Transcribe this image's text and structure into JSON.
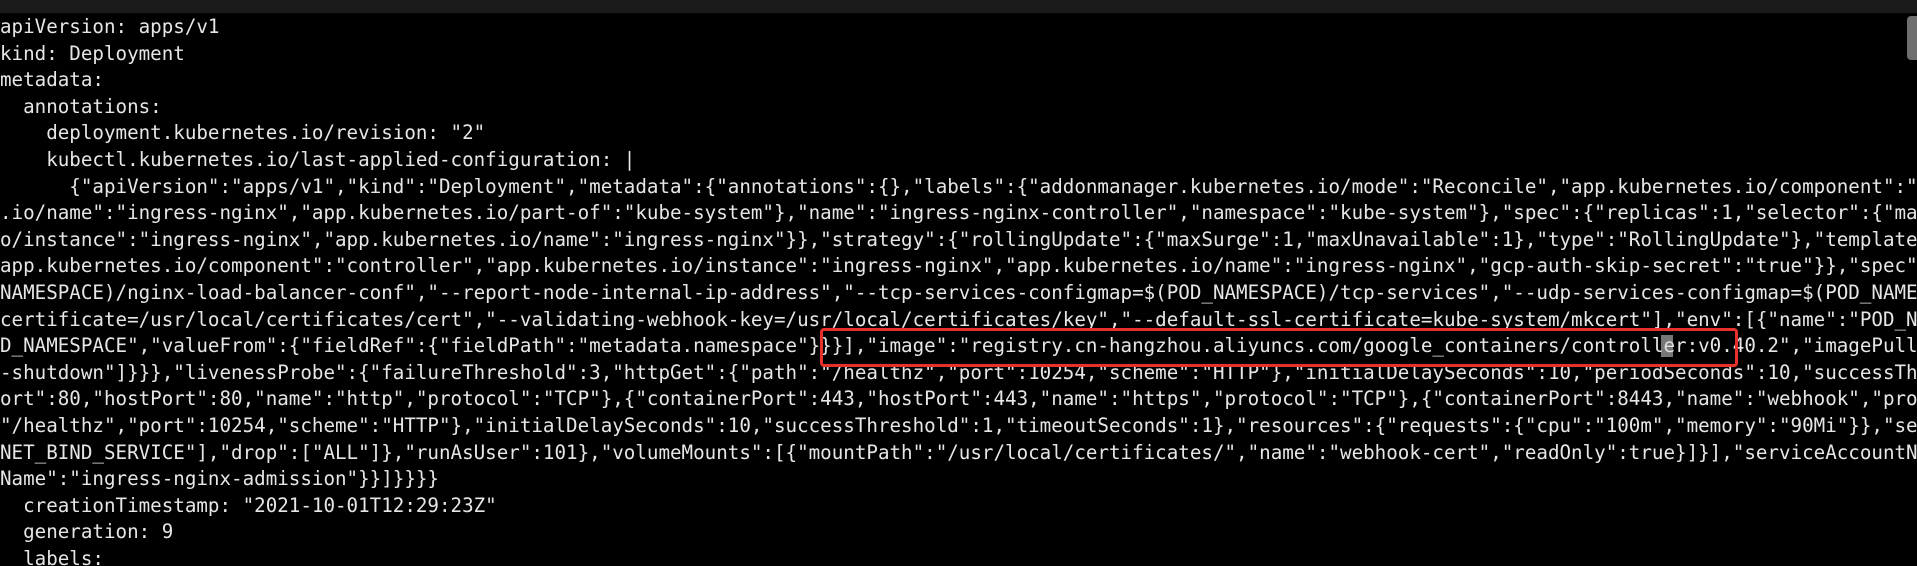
{
  "terminal": {
    "lines": [
      "apiVersion: apps/v1",
      "kind: Deployment",
      "metadata:",
      "  annotations:",
      "    deployment.kubernetes.io/revision: \"2\"",
      "    kubectl.kubernetes.io/last-applied-configuration: |",
      "      {\"apiVersion\":\"apps/v1\",\"kind\":\"Deployment\",\"metadata\":{\"annotations\":{},\"labels\":{\"addonmanager.kubernetes.io/mode\":\"Reconcile\",\"app.kubernetes.io/component\":\"contr",
      ".io/name\":\"ingress-nginx\",\"app.kubernetes.io/part-of\":\"kube-system\"},\"name\":\"ingress-nginx-controller\",\"namespace\":\"kube-system\"},\"spec\":{\"replicas\":1,\"selector\":{\"matchLa",
      "o/instance\":\"ingress-nginx\",\"app.kubernetes.io/name\":\"ingress-nginx\"}},\"strategy\":{\"rollingUpdate\":{\"maxSurge\":1,\"maxUnavailable\":1},\"type\":\"RollingUpdate\"},\"template\":{\"m",
      "app.kubernetes.io/component\":\"controller\",\"app.kubernetes.io/instance\":\"ingress-nginx\",\"app.kubernetes.io/name\":\"ingress-nginx\",\"gcp-auth-skip-secret\":\"true\"}},\"spec\":{\"co",
      "NAMESPACE)/nginx-load-balancer-conf\",\"--report-node-internal-ip-address\",\"--tcp-services-configmap=$(POD_NAMESPACE)/tcp-services\",\"--udp-services-configmap=$(POD_NAMESPACE",
      "certificate=/usr/local/certificates/cert\",\"--validating-webhook-key=/usr/local/certificates/key\",\"--default-ssl-certificate=kube-system/mkcert\"],\"env\":[{\"name\":\"POD_NAME\",",
      "D_NAMESPACE\",\"valueFrom\":{\"fieldRef\":{\"fieldPath\":\"metadata.namespace\"}}}],\"image\":\"registry.cn-hangzhou.aliyuncs.com/google_containers/controller:v0.40.2\",\"imagePullPolic",
      "-shutdown\"]}}},\"livenessProbe\":{\"failureThreshold\":3,\"httpGet\":{\"path\":\"/healthz\",\"port\":10254,\"scheme\":\"HTTP\"},\"initialDelaySeconds\":10,\"periodSeconds\":10,\"successThresh",
      "ort\":80,\"hostPort\":80,\"name\":\"http\",\"protocol\":\"TCP\"},{\"containerPort\":443,\"hostPort\":443,\"name\":\"https\",\"protocol\":\"TCP\"},{\"containerPort\":8443,\"name\":\"webhook\",\"protocol",
      "\"/healthz\",\"port\":10254,\"scheme\":\"HTTP\"},\"initialDelaySeconds\":10,\"successThreshold\":1,\"timeoutSeconds\":1},\"resources\":{\"requests\":{\"cpu\":\"100m\",\"memory\":\"90Mi\"}},\"securi",
      "NET_BIND_SERVICE\"],\"drop\":[\"ALL\"]},\"runAsUser\":101},\"volumeMounts\":[{\"mountPath\":\"/usr/local/certificates/\",\"name\":\"webhook-cert\",\"readOnly\":true}]}],\"serviceAccountName\":",
      "Name\":\"ingress-nginx-admission\"}}]}}}}",
      "  creationTimestamp: \"2021-10-01T12:29:23Z\"",
      "  generation: 9",
      "  labels:"
    ]
  },
  "annotation": {
    "color": "#e8312a",
    "highlighted_text": "\"image\":\"registry.cn-hangzhou.aliyuncs.com/google_containers/controller:v0.40.2\""
  },
  "colors": {
    "background": "#000000",
    "text": "#e6e6e6",
    "highlight_border": "#e8312a"
  }
}
